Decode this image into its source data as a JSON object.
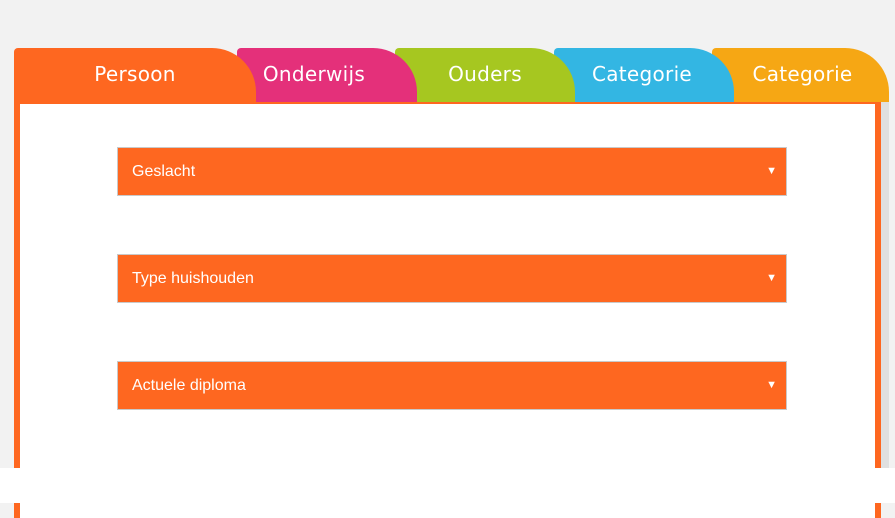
{
  "tabs": [
    {
      "label": "Persoon",
      "color": "#fe6720"
    },
    {
      "label": "Onderwijs",
      "color": "#e4307a"
    },
    {
      "label": "Ouders",
      "color": "#a6c720"
    },
    {
      "label": "Categorie",
      "color": "#33b6e3"
    },
    {
      "label": "Categorie",
      "color": "#f6a714"
    }
  ],
  "form": {
    "fields": [
      {
        "value": "Geslacht"
      },
      {
        "value": "Type huishouden"
      },
      {
        "value": "Actuele diploma"
      }
    ]
  },
  "colors": {
    "accent": "#fe6720",
    "page_background": "#f2f2f2",
    "panel_background": "#ffffff"
  }
}
